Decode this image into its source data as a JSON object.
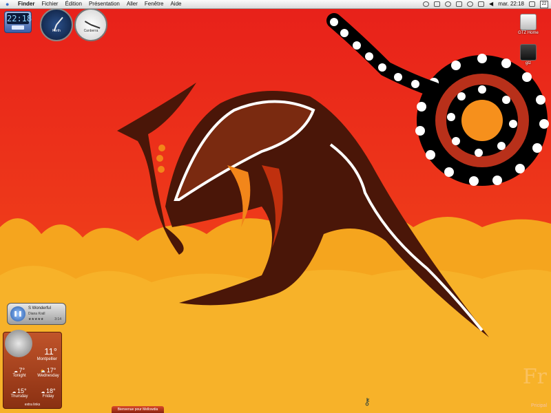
{
  "menubar": {
    "app_name": "Finder",
    "items": [
      "Fichier",
      "Édition",
      "Présentation",
      "Aller",
      "Fenêtre",
      "Aide"
    ],
    "clock": "mar. 22:18",
    "calendar_day": "22"
  },
  "desktop_icons": [
    {
      "label": "GTZ Home",
      "icon": "hard-drive-icon"
    },
    {
      "label": "gtz",
      "icon": "external-drive-icon"
    }
  ],
  "widgets": {
    "digital_clock": {
      "time": "22:18"
    },
    "world_clocks": [
      {
        "city": "Perth"
      },
      {
        "city": "Canberra"
      }
    ],
    "itunes": {
      "track": "S Wonderful",
      "artist": "Diana Krall",
      "rating": "★★★★★",
      "length": "3:14"
    },
    "weather": {
      "current_temp": "11°",
      "city": "Montpellier",
      "forecast": [
        {
          "day": "Tonight",
          "temp": "7°",
          "icon": "cloud-rain-icon"
        },
        {
          "day": "Wednesday",
          "temp": "17°",
          "icon": "partly-cloudy-icon"
        },
        {
          "day": "Thursday",
          "temp": "15°",
          "icon": "cloud-rain-icon"
        },
        {
          "day": "Friday",
          "temp": "18°",
          "icon": "cloud-rain-icon"
        }
      ],
      "footer": "extra links"
    }
  },
  "taskbar": {
    "tab_label": "Bienvenue pour Mellowdia"
  },
  "workspace_label": "Pricipal",
  "signature": "Fr",
  "colors": {
    "wallpaper_red": "#e8261c",
    "flame_orange": "#f4891a",
    "kangaroo_brown": "#4a1608"
  }
}
